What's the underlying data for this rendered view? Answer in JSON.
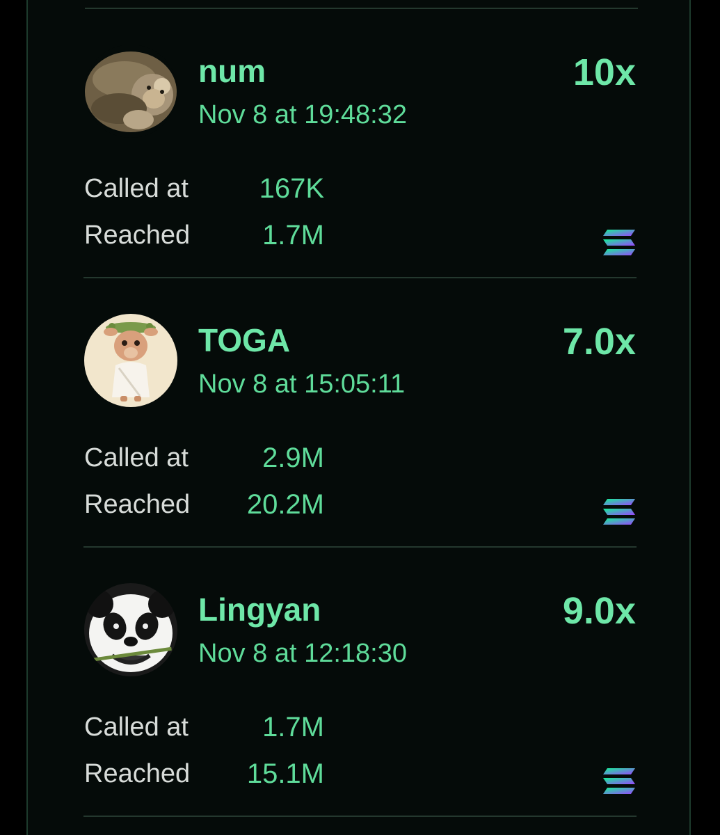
{
  "calls": [
    {
      "name": "num",
      "time": "Nov 8 at 19:48:32",
      "multiplier": "10x",
      "called_at_label": "Called at",
      "called_at": "167K",
      "reached_label": "Reached",
      "reached": "1.7M",
      "avatar": "hamster-avatar",
      "chain_icon": "solana-icon"
    },
    {
      "name": "TOGA",
      "time": "Nov 8 at 15:05:11",
      "multiplier": "7.0x",
      "called_at_label": "Called at",
      "called_at": "2.9M",
      "reached_label": "Reached",
      "reached": "20.2M",
      "avatar": "toga-llama-avatar",
      "chain_icon": "solana-icon"
    },
    {
      "name": "Lingyan",
      "time": "Nov 8 at 12:18:30",
      "multiplier": "9.0x",
      "called_at_label": "Called at",
      "called_at": "1.7M",
      "reached_label": "Reached",
      "reached": "15.1M",
      "avatar": "panda-avatar",
      "chain_icon": "solana-icon"
    }
  ],
  "colors": {
    "accent_green": "#6ee7a8",
    "label_gray": "#d8dcd9",
    "panel_background": "#050b09",
    "divider": "#24382e",
    "solana_gradient": [
      "#9945ff",
      "#14f195"
    ]
  }
}
